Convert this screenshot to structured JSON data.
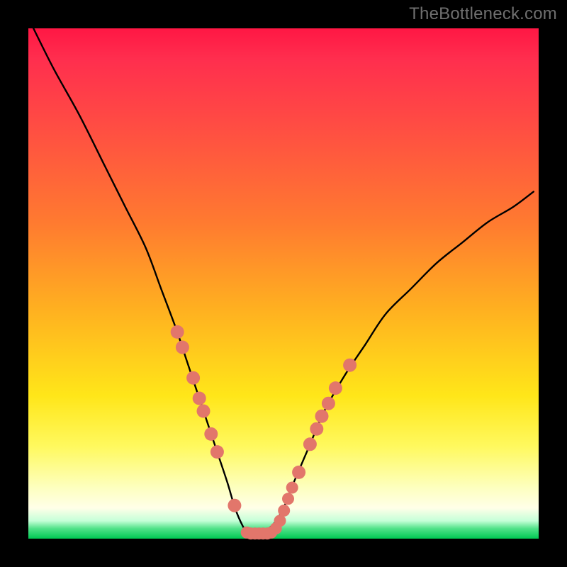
{
  "watermark": "TheBottleneck.com",
  "colors": {
    "background": "#000000",
    "marker": "#e2766b",
    "curve": "#000000",
    "gradient_top": "#ff1744",
    "gradient_bottom": "#00c853"
  },
  "chart_data": {
    "type": "line",
    "title": "",
    "xlabel": "",
    "ylabel": "",
    "xlim": [
      0,
      100
    ],
    "ylim": [
      0,
      100
    ],
    "annotations": [
      "TheBottleneck.com"
    ],
    "series": [
      {
        "name": "curve",
        "x": [
          1,
          5,
          10,
          15,
          19,
          23,
          26,
          29,
          31,
          33,
          35,
          37,
          39,
          40.5,
          42,
          43,
          44,
          44.5,
          45.5,
          48,
          50,
          52,
          55,
          58,
          62,
          66,
          70,
          75,
          80,
          85,
          90,
          95,
          99
        ],
        "y": [
          100,
          92,
          83,
          73,
          65,
          57,
          49,
          41,
          35,
          29,
          23,
          17,
          11,
          6,
          2.5,
          1.2,
          1,
          1,
          1,
          2.8,
          6,
          11,
          18,
          25,
          32,
          38,
          44,
          49,
          54,
          58,
          62,
          65,
          68
        ]
      }
    ],
    "markers_left": [
      {
        "x": 29.2,
        "y": 40.5
      },
      {
        "x": 30.2,
        "y": 37.5
      },
      {
        "x": 32.3,
        "y": 31.5
      },
      {
        "x": 33.5,
        "y": 27.5
      },
      {
        "x": 34.3,
        "y": 25.0
      },
      {
        "x": 35.8,
        "y": 20.5
      },
      {
        "x": 37.0,
        "y": 17.0
      },
      {
        "x": 40.4,
        "y": 6.5
      }
    ],
    "markers_right": [
      {
        "x": 53.0,
        "y": 13.0
      },
      {
        "x": 55.2,
        "y": 18.5
      },
      {
        "x": 56.5,
        "y": 21.5
      },
      {
        "x": 57.5,
        "y": 24.0
      },
      {
        "x": 58.8,
        "y": 26.5
      },
      {
        "x": 60.2,
        "y": 29.5
      },
      {
        "x": 63.0,
        "y": 34.0
      }
    ],
    "flat_markers": [
      {
        "x": 42.8,
        "y": 1.2
      },
      {
        "x": 43.6,
        "y": 1.0
      },
      {
        "x": 44.4,
        "y": 1.0
      },
      {
        "x": 45.2,
        "y": 1.0
      },
      {
        "x": 46.0,
        "y": 1.0
      },
      {
        "x": 46.8,
        "y": 1.0
      },
      {
        "x": 47.6,
        "y": 1.2
      },
      {
        "x": 48.5,
        "y": 2.0
      },
      {
        "x": 49.3,
        "y": 3.5
      },
      {
        "x": 50.1,
        "y": 5.5
      },
      {
        "x": 50.9,
        "y": 7.8
      },
      {
        "x": 51.7,
        "y": 10.0
      }
    ]
  }
}
